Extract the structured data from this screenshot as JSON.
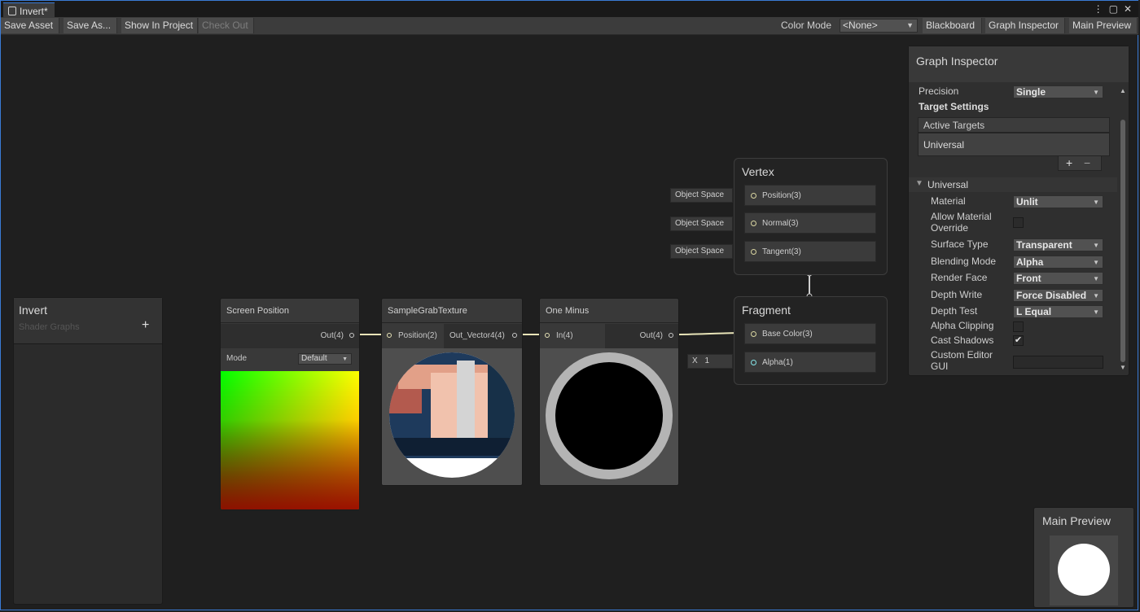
{
  "window": {
    "tab_title": "Invert*"
  },
  "toolbar": {
    "save_asset": "Save Asset",
    "save_as": "Save As...",
    "show_in_project": "Show In Project",
    "check_out": "Check Out",
    "color_mode_label": "Color Mode",
    "color_mode_value": "<None>",
    "blackboard": "Blackboard",
    "graph_inspector": "Graph Inspector",
    "main_preview": "Main Preview"
  },
  "blackboard": {
    "title": "Invert",
    "subtitle": "Shader Graphs",
    "add": "+"
  },
  "nodes": {
    "screen_position": {
      "title": "Screen Position",
      "out": "Out(4)",
      "mode_label": "Mode",
      "mode_value": "Default"
    },
    "sample_grab": {
      "title": "SampleGrabTexture",
      "in": "Position(2)",
      "out": "Out_Vector4(4)"
    },
    "one_minus": {
      "title": "One Minus",
      "in": "In(4)",
      "out": "Out(4)"
    }
  },
  "vertex": {
    "title": "Vertex",
    "ports": [
      {
        "label": "Position(3)",
        "field": "Object Space"
      },
      {
        "label": "Normal(3)",
        "field": "Object Space"
      },
      {
        "label": "Tangent(3)",
        "field": "Object Space"
      }
    ]
  },
  "fragment": {
    "title": "Fragment",
    "base_color": "Base Color(3)",
    "alpha": "Alpha(1)",
    "alpha_field_label": "X",
    "alpha_field_value": "1"
  },
  "inspector": {
    "title": "Graph Inspector",
    "precision_label": "Precision",
    "precision_value": "Single",
    "target_settings": "Target Settings",
    "active_targets": "Active Targets",
    "target_item": "Universal",
    "section": "Universal",
    "rows": [
      {
        "label": "Material",
        "value": "Unlit"
      },
      {
        "label": "Surface Type",
        "value": "Transparent"
      },
      {
        "label": "Blending Mode",
        "value": "Alpha"
      },
      {
        "label": "Render Face",
        "value": "Front"
      },
      {
        "label": "Depth Write",
        "value": "Force Disabled"
      },
      {
        "label": "Depth Test",
        "value": "L Equal"
      }
    ],
    "allow_override_1": "Allow Material",
    "allow_override_2": "Override",
    "alpha_clipping": "Alpha Clipping",
    "cast_shadows": "Cast Shadows",
    "custom_editor_1": "Custom Editor",
    "custom_editor_2": "GUI",
    "alpha_clipping_checked": false,
    "cast_shadows_checked": true
  },
  "main_preview": {
    "title": "Main Preview"
  },
  "colors": {
    "accent": "#3a7bd5",
    "wire": "#e8e4b8",
    "wire_float": "#84e4e7"
  }
}
